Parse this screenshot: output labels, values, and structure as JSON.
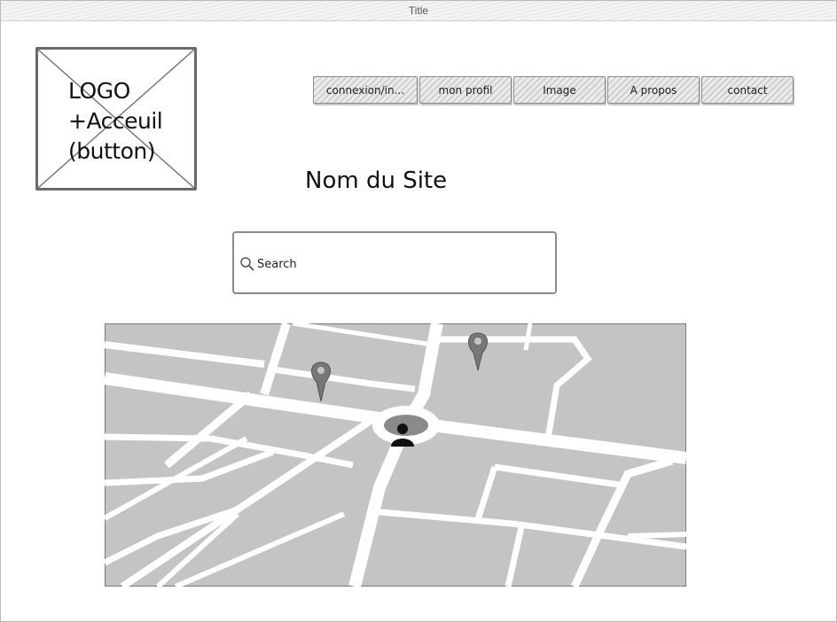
{
  "window": {
    "title": "Title"
  },
  "logo": {
    "text": "LOGO\n+Acceuil\n(button)"
  },
  "nav": {
    "items": [
      {
        "label": "connexion/in..."
      },
      {
        "label": "mon profil"
      },
      {
        "label": "Image"
      },
      {
        "label": "A propos"
      },
      {
        "label": "contact"
      }
    ]
  },
  "site": {
    "name": "Nom du Site"
  },
  "search": {
    "placeholder": "Search",
    "value": ""
  },
  "map": {
    "pins": [
      {
        "icon": "map-pin-icon"
      },
      {
        "icon": "map-pin-icon"
      }
    ],
    "user_marker": {
      "icon": "user-location-icon"
    }
  },
  "colors": {
    "map_block": "#c4c4c4",
    "map_road": "#ffffff",
    "map_border": "#7a7a7a",
    "button_hatch": "#cfcfcf",
    "sketch_stroke": "#6a6a6a"
  }
}
